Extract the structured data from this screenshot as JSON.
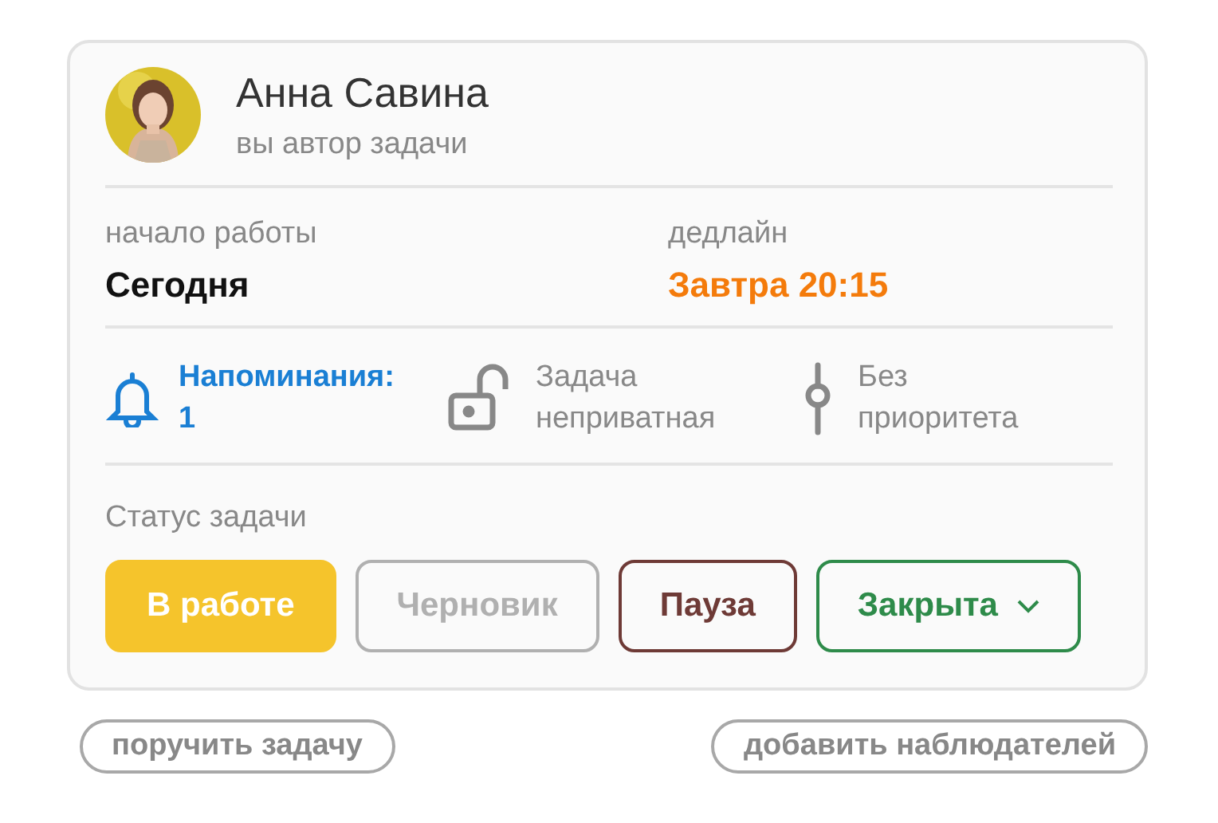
{
  "author": {
    "name": "Анна Савина",
    "role": "вы автор задачи"
  },
  "dates": [
    {
      "label": "начало работы",
      "value": "Сегодня",
      "overdue": false
    },
    {
      "label": "дедлайн",
      "value": "Завтра 20:15",
      "overdue": true
    }
  ],
  "info": [
    {
      "kind": "reminder",
      "lines": [
        "Напоминания:",
        "1"
      ],
      "active": true
    },
    {
      "kind": "privacy",
      "lines": [
        "Задача",
        "неприватная"
      ],
      "active": false
    },
    {
      "kind": "priority",
      "lines": [
        "Без",
        "приоритета"
      ],
      "active": false
    }
  ],
  "status": {
    "label": "Статус задачи",
    "options": [
      {
        "label": "В работе",
        "color": "#f5c42c",
        "selected": true,
        "kind": "button"
      },
      {
        "label": "Черновик",
        "color": "#b0b0b0",
        "selected": false,
        "kind": "button"
      },
      {
        "label": "Пауза",
        "color": "#6e3a36",
        "selected": false,
        "kind": "button"
      },
      {
        "label": "Закрыта",
        "color": "#2e8b4a",
        "selected": false,
        "kind": "dropdown"
      }
    ]
  },
  "actions": [
    "поручить задачу",
    "добавить наблюдателей"
  ]
}
